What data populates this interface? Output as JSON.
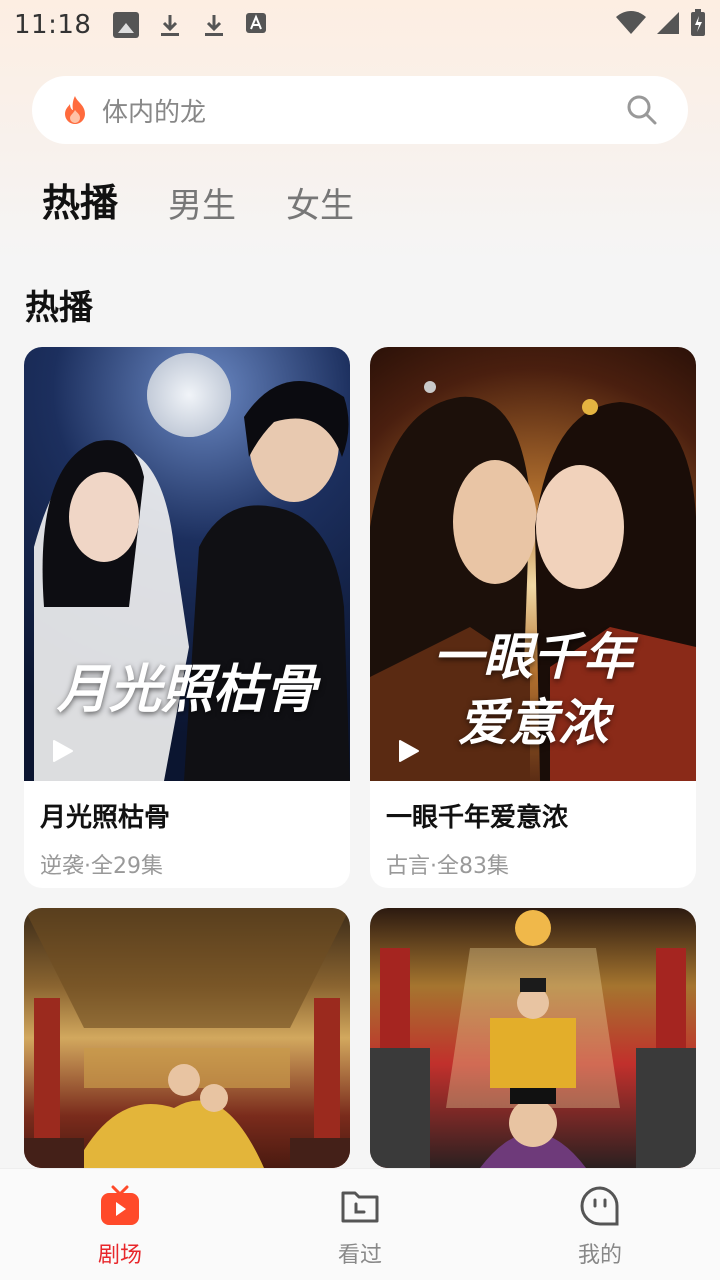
{
  "status_bar": {
    "time": "11:18",
    "icons": [
      "photo-icon",
      "download-icon",
      "download-icon",
      "font-a-icon",
      "wifi-icon",
      "signal-icon",
      "battery-charging-icon"
    ]
  },
  "search": {
    "placeholder": "体内的龙",
    "icons": [
      "fire-icon",
      "search-icon"
    ]
  },
  "tabs": [
    {
      "label": "热播",
      "active": true
    },
    {
      "label": "男生",
      "active": false
    },
    {
      "label": "女生",
      "active": false
    }
  ],
  "section": {
    "title": "热播"
  },
  "dramas": [
    {
      "name": "月光照枯骨",
      "meta": "逆袭·全29集",
      "poster_text": "月光照枯骨"
    },
    {
      "name": "一眼千年爱意浓",
      "meta": "古言·全83集",
      "poster_text_line1": "一眼千年",
      "poster_text_line2": "爱意浓"
    },
    {
      "name": "",
      "meta": ""
    },
    {
      "name": "",
      "meta": ""
    }
  ],
  "bottom_nav": [
    {
      "label": "剧场",
      "icon": "tv-play-icon",
      "active": true
    },
    {
      "label": "看过",
      "icon": "history-folder-icon",
      "active": false
    },
    {
      "label": "我的",
      "icon": "profile-bubble-icon",
      "active": false
    }
  ],
  "colors": {
    "accent": "#e8272b",
    "background": "#f5f5f5",
    "card": "#ffffff"
  }
}
